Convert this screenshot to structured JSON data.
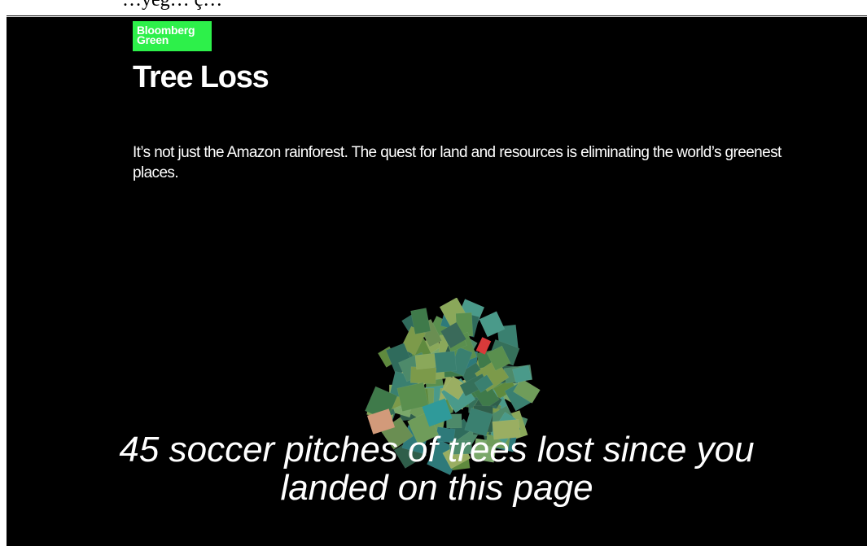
{
  "top_strip_text": "…yeg… ç…",
  "logo": {
    "line1": "Bloomberg",
    "line2": "Green"
  },
  "page_title": "Tree Loss",
  "deck": "It’s not just the Amazon rainforest. The quest for land and resources is eliminating the world’s greenest places.",
  "counter": {
    "count": "45",
    "suffix_line1": "soccer pitches of trees lost since you",
    "line2": "landed on this page"
  },
  "colors": {
    "brand_green": "#2df04a",
    "background": "#000000",
    "text": "#ffffff"
  }
}
